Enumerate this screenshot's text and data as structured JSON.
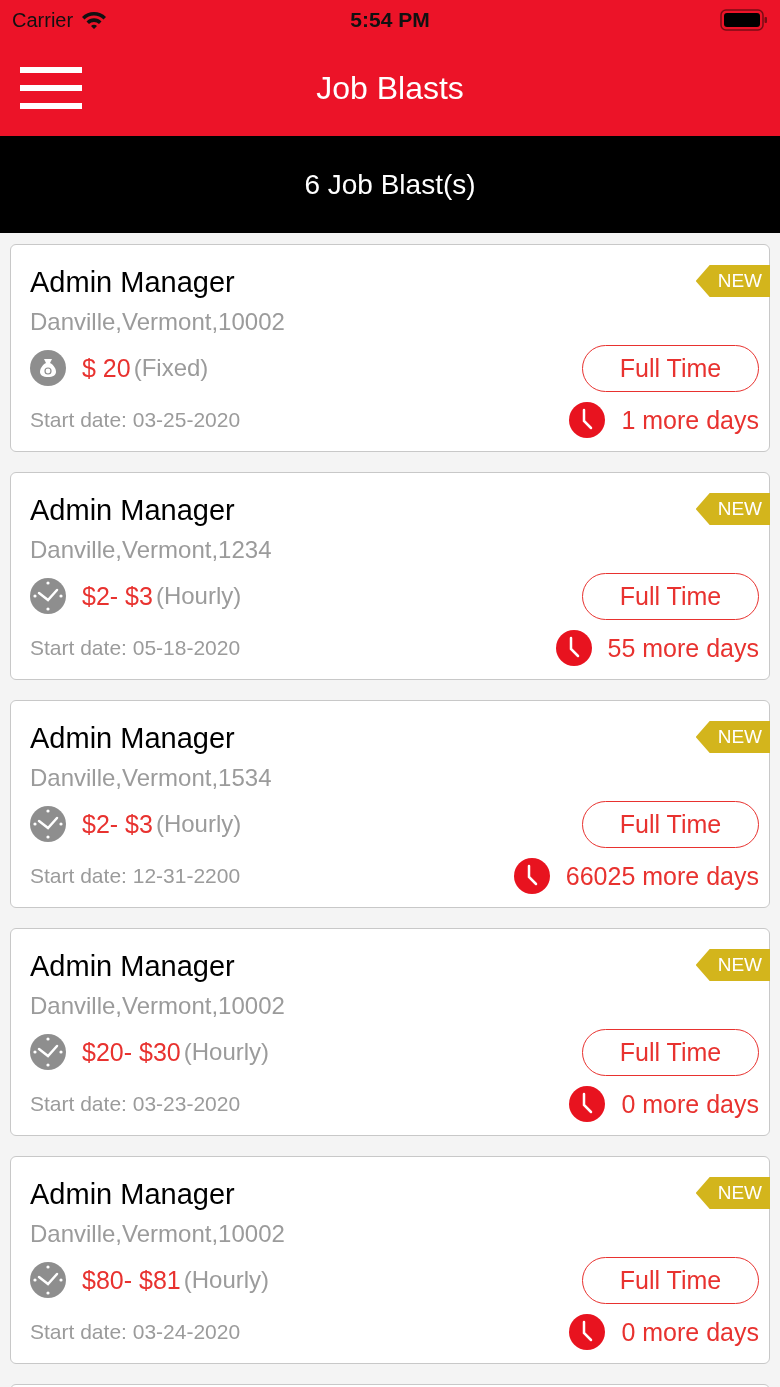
{
  "status_bar": {
    "carrier": "Carrier",
    "time": "5:54 PM"
  },
  "nav": {
    "title": "Job Blasts"
  },
  "summary": "6 Job Blast(s)",
  "jobs": [
    {
      "title": "Admin Manager",
      "location": "Danville,Vermont,10002",
      "kind": "fixed",
      "pay": "$ 20",
      "pay_unit": "(Fixed)",
      "type": "Full Time",
      "start": "Start date: 03-25-2020",
      "remaining": "1 more days",
      "badge": "NEW"
    },
    {
      "title": "Admin Manager",
      "location": "Danville,Vermont,1234",
      "kind": "hourly",
      "pay": "$2- $3",
      "pay_unit": "(Hourly)",
      "type": "Full Time",
      "start": "Start date: 05-18-2020",
      "remaining": "55 more days",
      "badge": "NEW"
    },
    {
      "title": "Admin Manager",
      "location": "Danville,Vermont,1534",
      "kind": "hourly",
      "pay": "$2- $3",
      "pay_unit": "(Hourly)",
      "type": "Full Time",
      "start": "Start date: 12-31-2200",
      "remaining": "66025 more days",
      "badge": "NEW"
    },
    {
      "title": "Admin Manager",
      "location": "Danville,Vermont,10002",
      "kind": "hourly",
      "pay": "$20- $30",
      "pay_unit": "(Hourly)",
      "type": "Full Time",
      "start": "Start date: 03-23-2020",
      "remaining": "0 more days",
      "badge": "NEW"
    },
    {
      "title": "Admin Manager",
      "location": "Danville,Vermont,10002",
      "kind": "hourly",
      "pay": "$80- $81",
      "pay_unit": "(Hourly)",
      "type": "Full Time",
      "start": "Start date: 03-24-2020",
      "remaining": "0 more days",
      "badge": "NEW"
    }
  ]
}
